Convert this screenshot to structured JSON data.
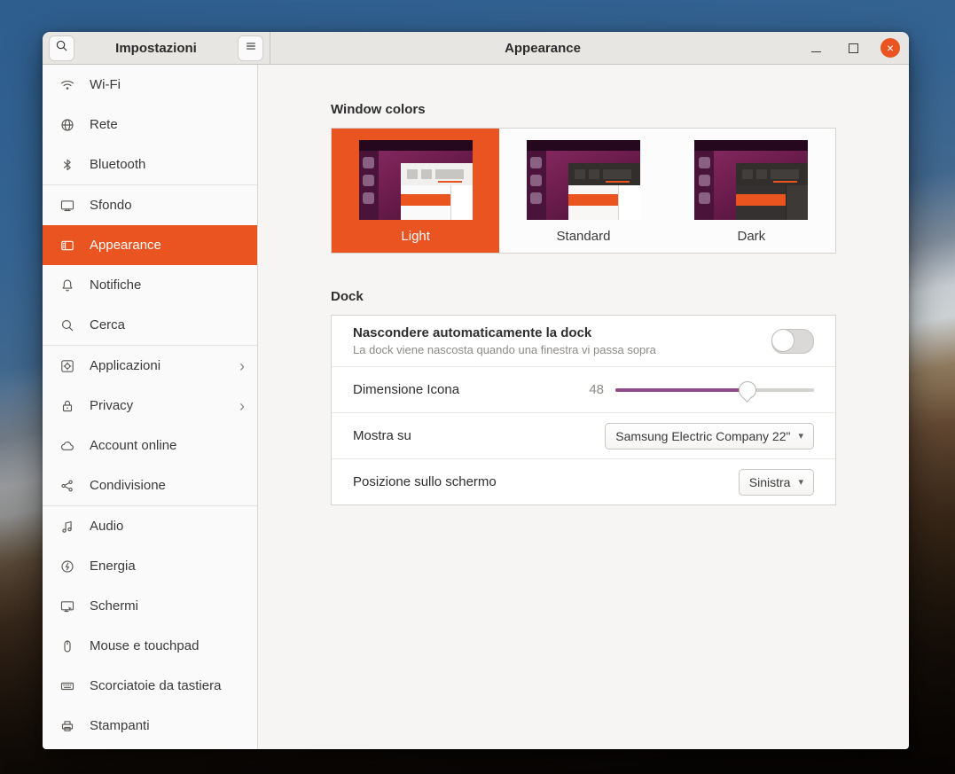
{
  "window": {
    "sidebar_header": {
      "title": "Impostazioni"
    },
    "main_header": {
      "title": "Appearance"
    },
    "icons": {
      "dropdown_arrow": "▾",
      "close": "×",
      "chevron": "›"
    },
    "accent_color": "#E95420",
    "slider_color": "#8E4C86",
    "sidebar": {
      "items": [
        {
          "label": "Wi-Fi",
          "icon": "wifi-icon"
        },
        {
          "label": "Rete",
          "icon": "network-icon"
        },
        {
          "label": "Bluetooth",
          "icon": "bluetooth-icon"
        },
        {
          "label": "Sfondo",
          "icon": "background-icon"
        },
        {
          "label": "Appearance",
          "icon": "appearance-icon",
          "selected": true
        },
        {
          "label": "Notifiche",
          "icon": "bell-icon"
        },
        {
          "label": "Cerca",
          "icon": "search-icon"
        },
        {
          "label": "Applicazioni",
          "icon": "applications-icon",
          "has_submenu": true
        },
        {
          "label": "Privacy",
          "icon": "lock-icon",
          "has_submenu": true
        },
        {
          "label": "Account online",
          "icon": "cloud-icon"
        },
        {
          "label": "Condivisione",
          "icon": "share-icon"
        },
        {
          "label": "Audio",
          "icon": "audio-icon"
        },
        {
          "label": "Energia",
          "icon": "power-icon"
        },
        {
          "label": "Schermi",
          "icon": "displays-icon"
        },
        {
          "label": "Mouse e touchpad",
          "icon": "mouse-icon"
        },
        {
          "label": "Scorciatoie da tastiera",
          "icon": "keyboard-icon"
        },
        {
          "label": "Stampanti",
          "icon": "printer-icon"
        }
      ]
    },
    "content": {
      "window_colors": {
        "title": "Window colors",
        "options": [
          {
            "label": "Light",
            "selected": true
          },
          {
            "label": "Standard",
            "selected": false
          },
          {
            "label": "Dark",
            "selected": false
          }
        ]
      },
      "dock": {
        "title": "Dock",
        "autohide": {
          "title": "Nascondere automaticamente la dock",
          "subtitle": "La dock viene nascosta quando una finestra vi passa sopra",
          "enabled": false
        },
        "icon_size": {
          "label": "Dimensione Icona",
          "value": "48",
          "percent": 66.5
        },
        "show_on": {
          "label": "Mostra su",
          "value": "Samsung Electric Company 22\""
        },
        "position": {
          "label": "Posizione sullo schermo",
          "value": "Sinistra"
        }
      }
    }
  }
}
